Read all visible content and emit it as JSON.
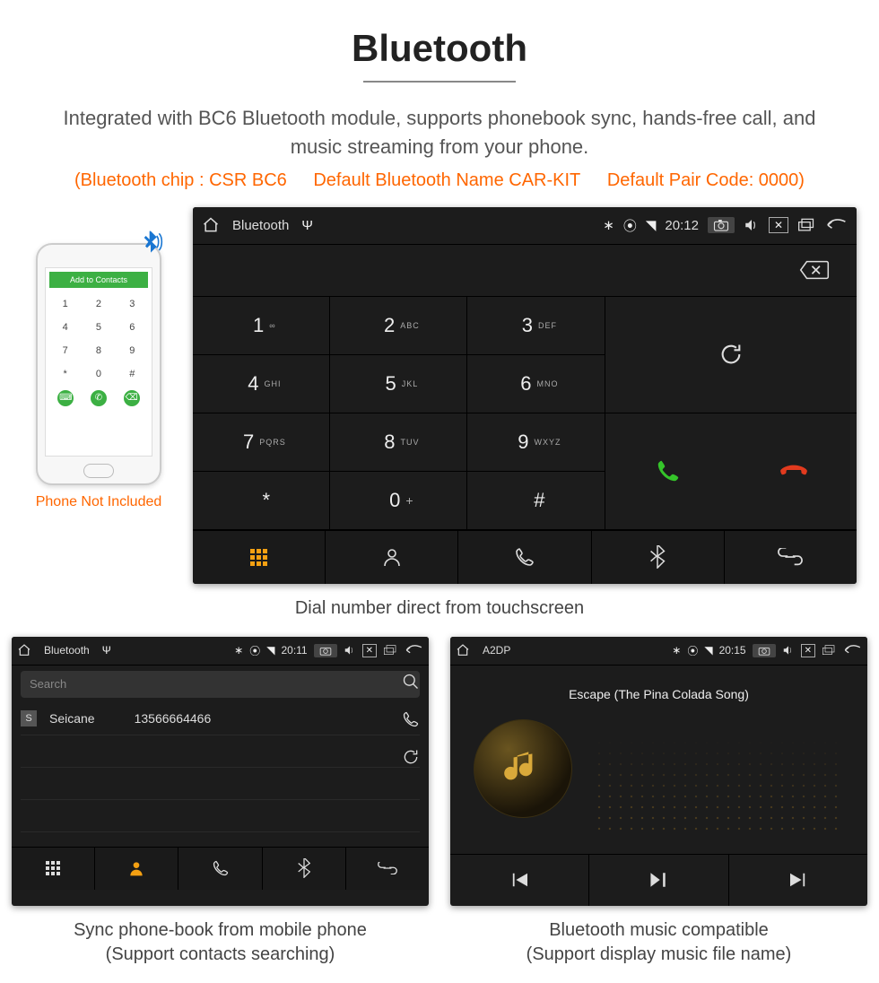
{
  "header": {
    "title": "Bluetooth",
    "desc": "Integrated with BC6 Bluetooth module, supports phonebook sync, hands-free call, and music streaming from your phone.",
    "spec_chip": "(Bluetooth chip : CSR BC6",
    "spec_name": "Default Bluetooth Name CAR-KIT",
    "spec_code": "Default Pair Code: 0000)"
  },
  "phone": {
    "topbar": "Add to Contacts",
    "note": "Phone Not Included"
  },
  "dialer": {
    "status": {
      "app": "Bluetooth",
      "time": "20:12"
    },
    "keys": [
      {
        "n": "1",
        "s": "∞"
      },
      {
        "n": "2",
        "s": "ABC"
      },
      {
        "n": "3",
        "s": "DEF"
      },
      {
        "n": "4",
        "s": "GHI"
      },
      {
        "n": "5",
        "s": "JKL"
      },
      {
        "n": "6",
        "s": "MNO"
      },
      {
        "n": "7",
        "s": "PQRS"
      },
      {
        "n": "8",
        "s": "TUV"
      },
      {
        "n": "9",
        "s": "WXYZ"
      },
      {
        "n": "*",
        "s": ""
      },
      {
        "n": "0",
        "s": "+"
      },
      {
        "n": "#",
        "s": ""
      }
    ],
    "caption": "Dial number direct from touchscreen"
  },
  "phonebook": {
    "status": {
      "app": "Bluetooth",
      "time": "20:11"
    },
    "search_placeholder": "Search",
    "contact": {
      "badge": "S",
      "name": "Seicane",
      "number": "13566664466"
    },
    "caption_l1": "Sync phone-book from mobile phone",
    "caption_l2": "(Support contacts searching)"
  },
  "music": {
    "status": {
      "app": "A2DP",
      "time": "20:15"
    },
    "track": "Escape (The Pina Colada Song)",
    "caption_l1": "Bluetooth music compatible",
    "caption_l2": "(Support display music file name)"
  }
}
